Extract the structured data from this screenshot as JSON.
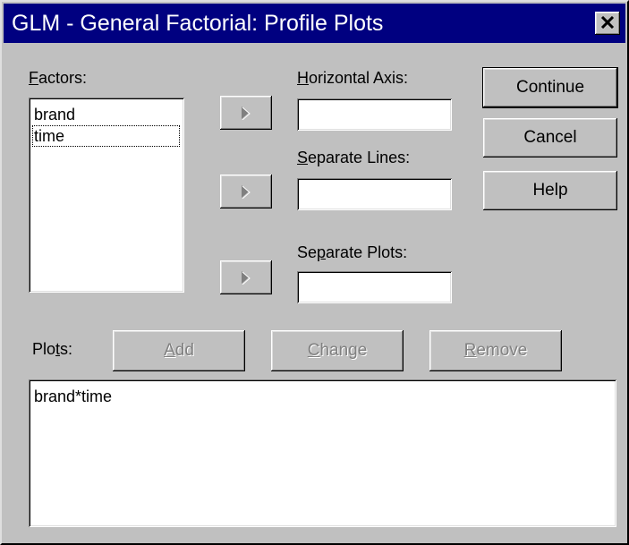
{
  "window": {
    "title": "GLM - General Factorial: Profile Plots",
    "close_icon": "close-icon"
  },
  "factors": {
    "label_prefix": "",
    "label_mnemonic": "F",
    "label_rest": "actors:",
    "items": [
      "brand",
      "time"
    ],
    "focused_item": "time"
  },
  "horizontal_axis": {
    "label_mnemonic": "H",
    "label_rest": "orizontal Axis:",
    "value": ""
  },
  "separate_lines": {
    "label_mnemonic": "S",
    "label_rest": "eparate Lines:",
    "value": ""
  },
  "separate_plots": {
    "label_pre": "Se",
    "label_mnemonic": "p",
    "label_rest": "arate Plots:",
    "value": ""
  },
  "buttons": {
    "continue": "Continue",
    "cancel": "Cancel",
    "help": "Help",
    "add_mnemonic": "A",
    "add_rest": "dd",
    "change_mnemonic": "C",
    "change_rest": "hange",
    "remove_mnemonic": "R",
    "remove_rest": "emove"
  },
  "plots": {
    "label_pre": "Plo",
    "label_mnemonic": "t",
    "label_rest": "s:",
    "items": [
      "brand*time"
    ]
  },
  "arrow_icon": "right-arrow-icon"
}
